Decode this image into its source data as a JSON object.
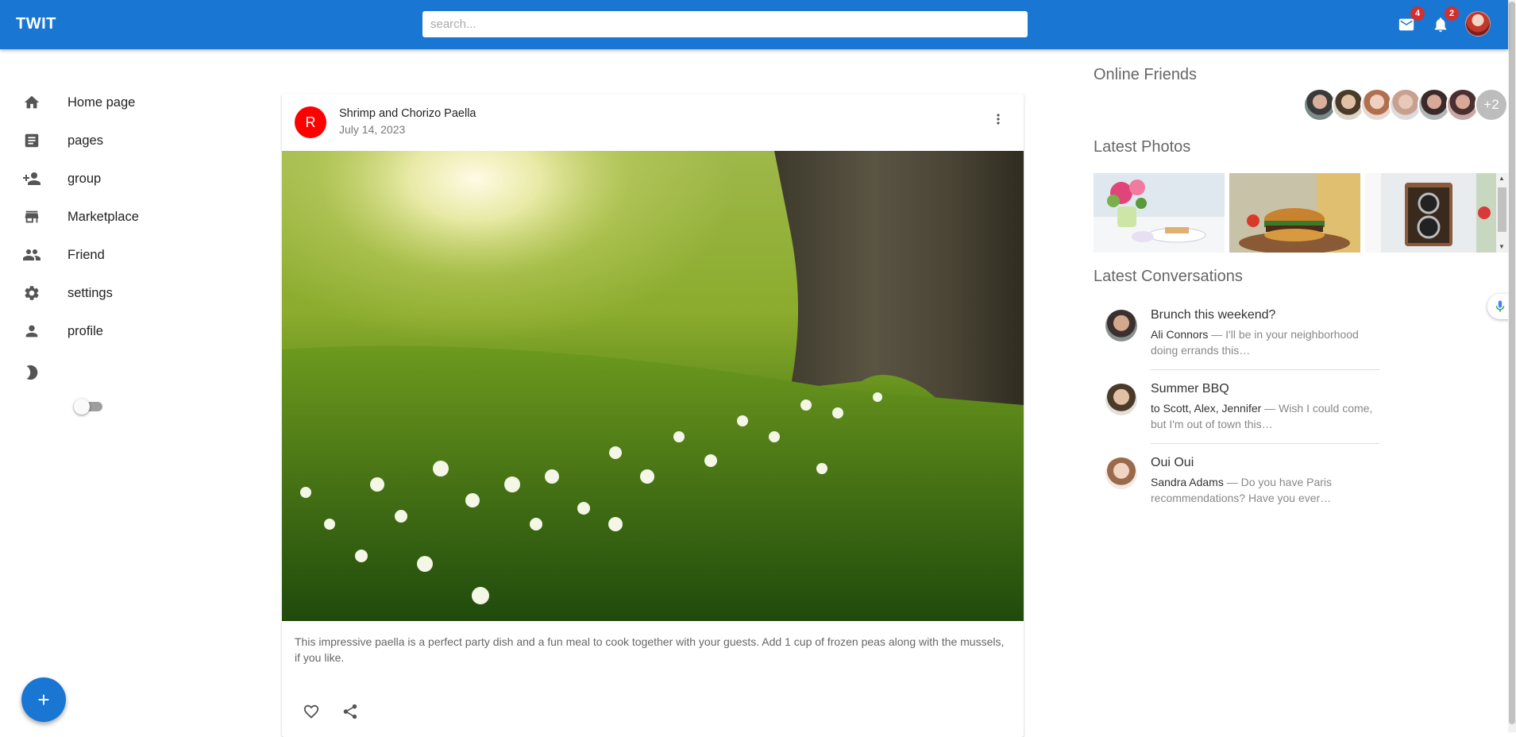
{
  "app": {
    "brand": "TWIT"
  },
  "header": {
    "search_placeholder": "search...",
    "mail_count": "4",
    "notification_count": "2"
  },
  "sidebar": {
    "items": [
      {
        "label": "Home page",
        "icon": "home-icon"
      },
      {
        "label": "pages",
        "icon": "article-icon"
      },
      {
        "label": "group",
        "icon": "group-add-icon"
      },
      {
        "label": "Marketplace",
        "icon": "storefront-icon"
      },
      {
        "label": "Friend",
        "icon": "people-icon"
      },
      {
        "label": "settings",
        "icon": "gear-icon"
      },
      {
        "label": "profile",
        "icon": "person-icon"
      }
    ],
    "dark_mode_enabled": false,
    "fab_label": "+"
  },
  "post": {
    "avatar_letter": "R",
    "title": "Shrimp and Chorizo Paella",
    "date": "July 14, 2023",
    "text": "This impressive paella is a perfect party dish and a fun meal to cook together with your guests. Add 1 cup of frozen peas along with the mussels, if you like."
  },
  "right": {
    "online_title": "Online Friends",
    "online_more": "+2",
    "photos_title": "Latest Photos",
    "conversations_title": "Latest Conversations",
    "conversations": [
      {
        "title": "Brunch this weekend?",
        "who": "Ali Connors",
        "msg": " — I'll be in your neighborhood doing errands this…"
      },
      {
        "title": "Summer BBQ",
        "who": "to Scott, Alex, Jennifer",
        "msg": " — Wish I could come, but I'm out of town this…"
      },
      {
        "title": "Oui Oui",
        "who": "Sandra Adams",
        "msg": " — Do you have Paris recommendations? Have you ever…"
      }
    ]
  },
  "colors": {
    "primary": "#1976d2",
    "badge": "#d32f2f",
    "post_avatar": "#ff0000"
  }
}
